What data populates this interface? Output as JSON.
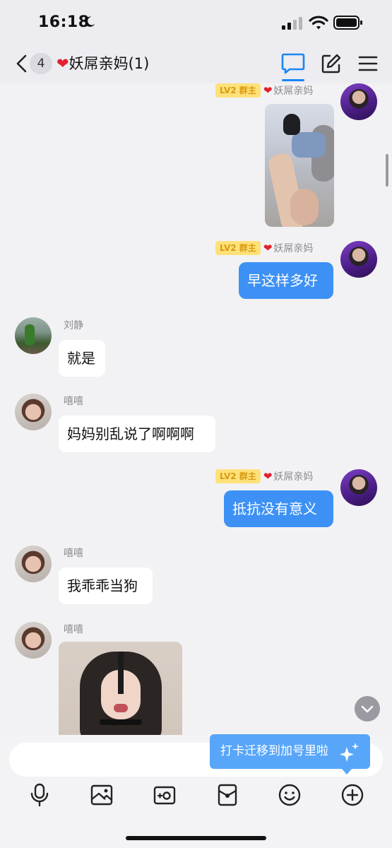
{
  "status_bar": {
    "time": "16:18",
    "icons": [
      "moon-icon",
      "signal-icon",
      "wifi-icon",
      "battery-icon"
    ]
  },
  "nav": {
    "unread_count": "4",
    "heart": "❤",
    "title": "妖屌亲妈(1)",
    "icons": [
      "back-icon",
      "chat-tab-icon",
      "edit-icon",
      "menu-icon"
    ],
    "accent_color": "#1a86f5"
  },
  "messages": {
    "m1": {
      "badge": "LV2 群主",
      "heart": "❤",
      "sender": "妖屌亲妈",
      "type": "image"
    },
    "m2": {
      "badge": "LV2 群主",
      "heart": "❤",
      "sender": "妖屌亲妈",
      "text": "早这样多好"
    },
    "m3": {
      "sender": "刘静",
      "text": "就是"
    },
    "m4": {
      "sender": "嘻嘻",
      "text": "妈妈别乱说了啊啊啊"
    },
    "m5": {
      "badge": "LV2 群主",
      "heart": "❤",
      "sender": "妖屌亲妈",
      "text": "抵抗没有意义"
    },
    "m6": {
      "sender": "嘻嘻",
      "text": "我乖乖当狗"
    },
    "m7": {
      "sender": "嘻嘻",
      "type": "image"
    }
  },
  "colors": {
    "outgoing_bubble": "#3d91f5",
    "incoming_bubble": "#ffffff",
    "owner_badge": "#ffe17a"
  },
  "tooltip": {
    "text": "打卡迁移到加号里啦",
    "icon": "sparkle-icon"
  },
  "input": {
    "value": "",
    "placeholder": ""
  },
  "toolbar": {
    "icons": [
      "microphone-icon",
      "image-icon",
      "camera-icon",
      "red-packet-icon",
      "emoji-icon",
      "plus-icon"
    ]
  }
}
